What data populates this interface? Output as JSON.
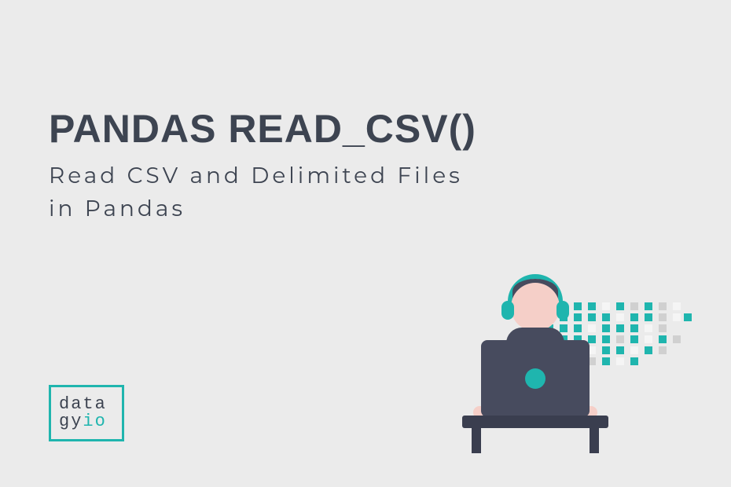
{
  "title": "PANDAS READ_CSV()",
  "subtitle_line1": "Read CSV and Delimited Files",
  "subtitle_line2": "in Pandas",
  "logo": {
    "line1": "data",
    "line2_part1": "gy",
    "line2_part2": "io"
  }
}
